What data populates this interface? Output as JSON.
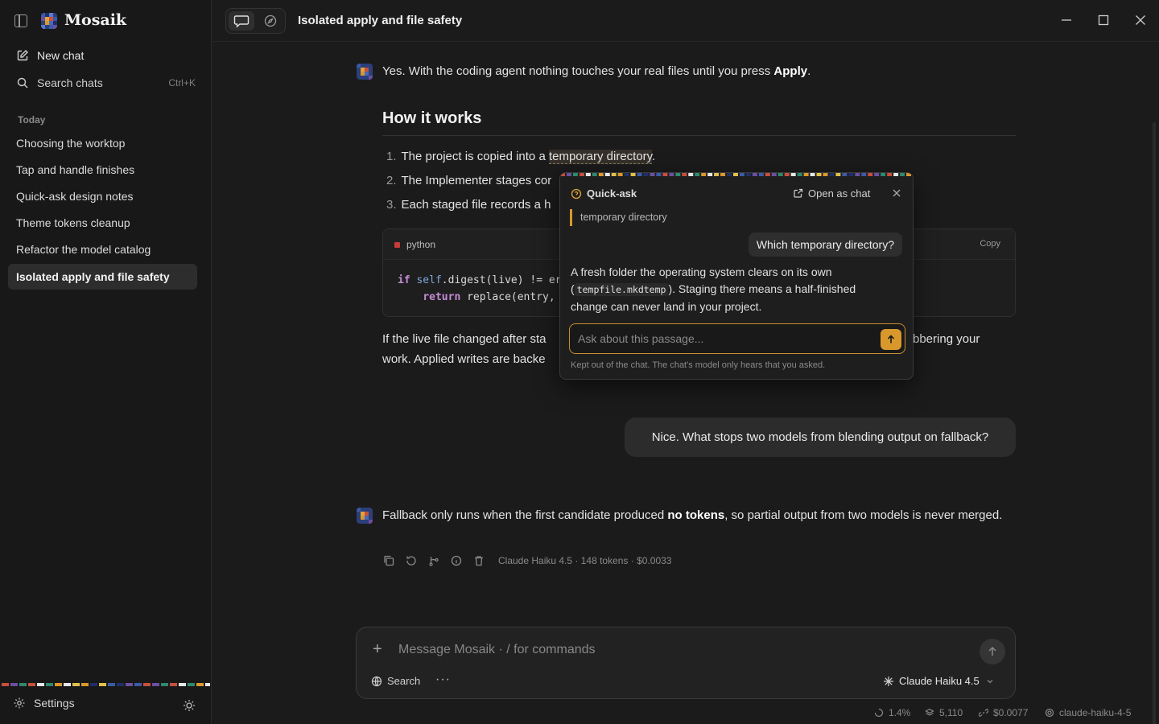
{
  "app": {
    "brand": "Mosaik"
  },
  "sidebar": {
    "new_chat": "New chat",
    "search": "Search chats",
    "search_shortcut": "Ctrl+K",
    "section": "Today",
    "chats": [
      "Choosing the worktop",
      "Tap and handle finishes",
      "Quick-ask design notes",
      "Theme tokens cleanup",
      "Refactor the model catalog",
      "Isolated apply and file safety"
    ],
    "active_chat": "Isolated apply and file safety",
    "settings": "Settings"
  },
  "header": {
    "title": "Isolated apply and file safety"
  },
  "conversation": {
    "assistant_1": {
      "pre": "Yes. With the coding agent nothing touches your real files until you press ",
      "bold": "Apply",
      "post": "."
    },
    "heading": "How it works",
    "steps": [
      {
        "num": "1.",
        "pre": "The project is copied into a ",
        "hl": "temporary directory",
        "post": "."
      },
      {
        "num": "2.",
        "text": "The Implementer stages cor"
      },
      {
        "num": "3.",
        "text": "Each staged file records a h"
      }
    ],
    "code": {
      "lang": "python",
      "copy": "Copy",
      "line1_kw": "if",
      "line1_obj": "self",
      "line1_rest": ".digest(live) != er",
      "line2_kw": "return",
      "line2_rest": " replace(entry,"
    },
    "para_line1_a": "If the live file changed after sta",
    "para_line1_b": "bbering your",
    "para_line2": "work. Applied writes are backe",
    "user_msg": "Nice. What stops two models from blending output on fallback?",
    "assistant_2": {
      "pre": "Fallback only runs when the first candidate produced ",
      "bold": "no tokens",
      "post": ", so partial output from two models is never merged."
    },
    "meta": "Claude Haiku 4.5 · 148 tokens · $0.0033"
  },
  "quick_ask": {
    "title": "Quick-ask",
    "open_as_chat": "Open as chat",
    "quote": "temporary directory",
    "question": "Which temporary directory?",
    "answer_pre": "A fresh folder the operating system clears on its own (",
    "answer_code": "tempfile.mkdtemp",
    "answer_post": "). Staging there means a half-finished change can never land in your project.",
    "input_placeholder": "Ask about this passage...",
    "footnote": "Kept out of the chat. The chat's model only hears that you asked.",
    "accent": "#d9982c"
  },
  "composer": {
    "placeholder": "Message Mosaik  ·  / for commands",
    "search": "Search",
    "model": "Claude Haiku 4.5"
  },
  "status": {
    "context": "1.4%",
    "tokens": "5,110",
    "cost": "$0.0077",
    "model_id": "claude-haiku-4-5"
  }
}
